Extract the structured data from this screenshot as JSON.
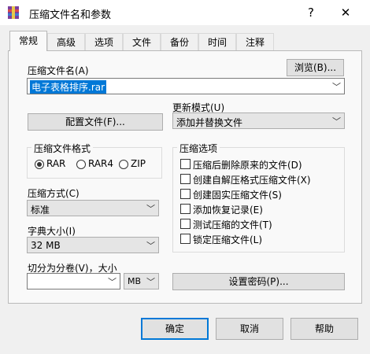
{
  "window": {
    "title": "压缩文件名和参数",
    "help_glyph": "?",
    "close_glyph": "✕",
    "icon": "winrar-icon"
  },
  "tabs": [
    {
      "label": "常规",
      "active": true
    },
    {
      "label": "高级"
    },
    {
      "label": "选项"
    },
    {
      "label": "文件"
    },
    {
      "label": "备份"
    },
    {
      "label": "时间"
    },
    {
      "label": "注释"
    }
  ],
  "general": {
    "archive_name_label": "压缩文件名(A)",
    "browse_button": "浏览(B)...",
    "archive_name_value": "电子表格排序.rar",
    "update_mode_label": "更新模式(U)",
    "update_mode_value": "添加并替换文件",
    "profiles_button": "配置文件(F)...",
    "format_group": {
      "title": "压缩文件格式",
      "options": [
        "RAR",
        "RAR4",
        "ZIP"
      ],
      "selected": "RAR"
    },
    "method_label": "压缩方式(C)",
    "method_value": "标准",
    "dict_label": "字典大小(I)",
    "dict_value": "32 MB",
    "split_label": "切分为分卷(V)，大小",
    "split_value": "",
    "split_unit": "MB",
    "options_group": {
      "title": "压缩选项",
      "items": [
        {
          "label": "压缩后删除原来的文件(D)",
          "checked": false
        },
        {
          "label": "创建自解压格式压缩文件(X)",
          "checked": false
        },
        {
          "label": "创建固实压缩文件(S)",
          "checked": false
        },
        {
          "label": "添加恢复记录(E)",
          "checked": false
        },
        {
          "label": "测试压缩的文件(T)",
          "checked": false
        },
        {
          "label": "锁定压缩文件(L)",
          "checked": false
        }
      ]
    },
    "password_button": "设置密码(P)..."
  },
  "buttons": {
    "ok": "确定",
    "cancel": "取消",
    "help": "帮助"
  },
  "colors": {
    "accent": "#0078d7",
    "window_bg": "#f0f0f0",
    "panel_bg": "#f9f9f9"
  }
}
